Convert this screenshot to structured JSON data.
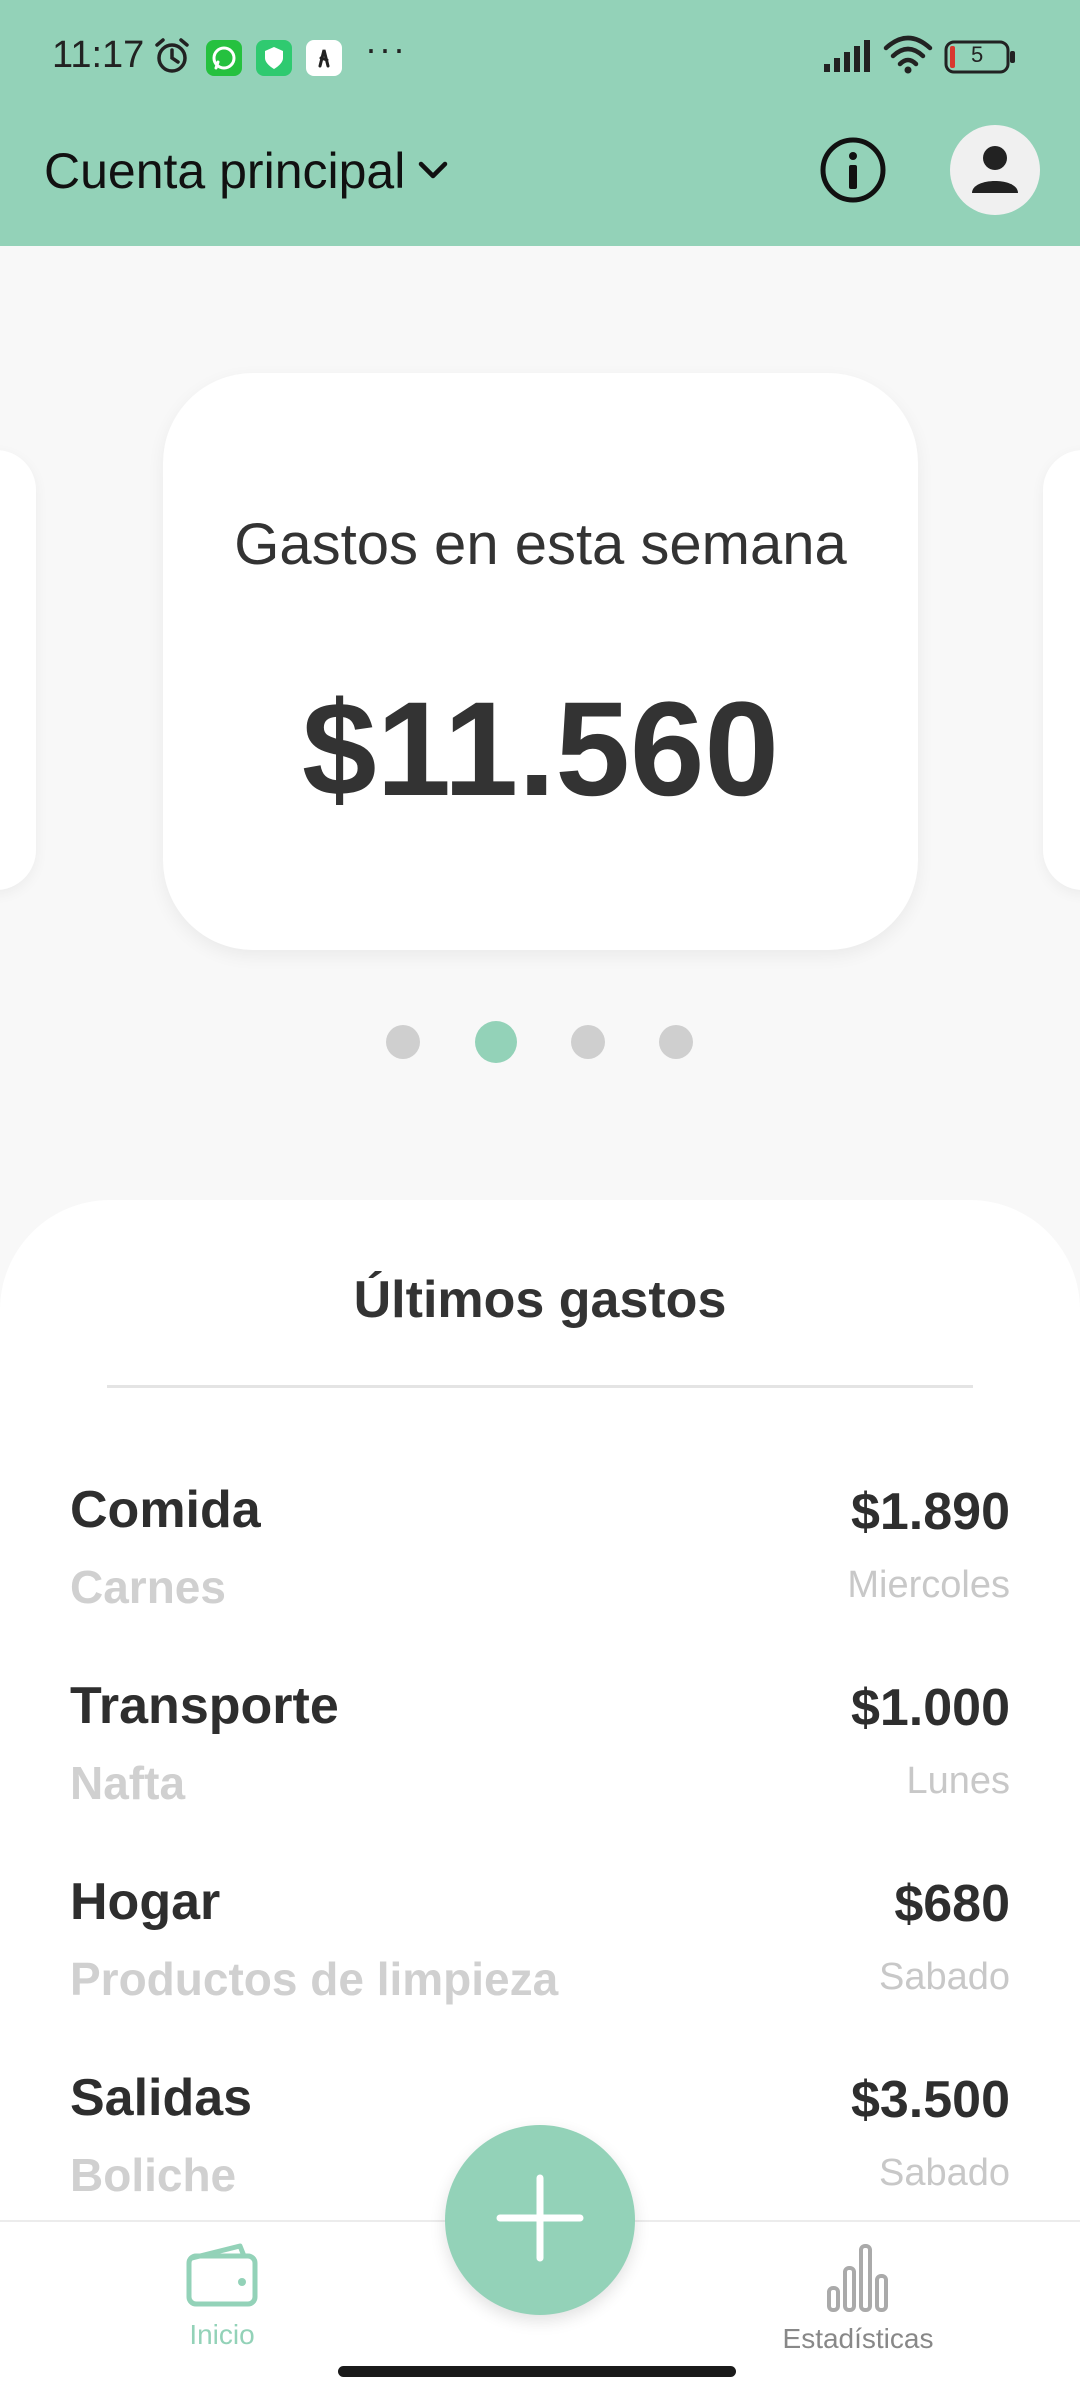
{
  "status_bar": {
    "time": "11:17",
    "icons": [
      "alarm-icon",
      "whatsapp-icon",
      "shield-app-icon",
      "app-icon",
      "more-dots-icon",
      "signal-icon",
      "wifi-icon",
      "battery-icon"
    ],
    "overflow": "···",
    "battery_level": "5"
  },
  "header": {
    "account_title": "Cuenta principal",
    "account_icon": "chevron-down-icon",
    "info_icon": "info-icon",
    "profile_icon": "user-icon"
  },
  "summary_card": {
    "label": "Gastos en esta semana",
    "amount": "$11.560"
  },
  "carousel": {
    "page_count": 4,
    "active_index": 1
  },
  "recent": {
    "title": "Últimos gastos",
    "items": [
      {
        "category": "Comida",
        "subcategory": "Carnes",
        "amount": "$1.890",
        "day": "Miercoles"
      },
      {
        "category": "Transporte",
        "subcategory": "Nafta",
        "amount": "$1.000",
        "day": "Lunes"
      },
      {
        "category": "Hogar",
        "subcategory": "Productos de limpieza",
        "amount": "$680",
        "day": "Sabado"
      },
      {
        "category": "Salidas",
        "subcategory": "Boliche",
        "amount": "$3.500",
        "day": "Sabado"
      }
    ]
  },
  "bottom_nav": {
    "home_label": "Inicio",
    "stats_label": "Estadísticas",
    "add_icon": "plus-icon"
  },
  "colors": {
    "accent": "#93d2b8",
    "text_dark": "#333333",
    "text_muted": "#d0d0d0",
    "background": "#f8f8f8"
  }
}
